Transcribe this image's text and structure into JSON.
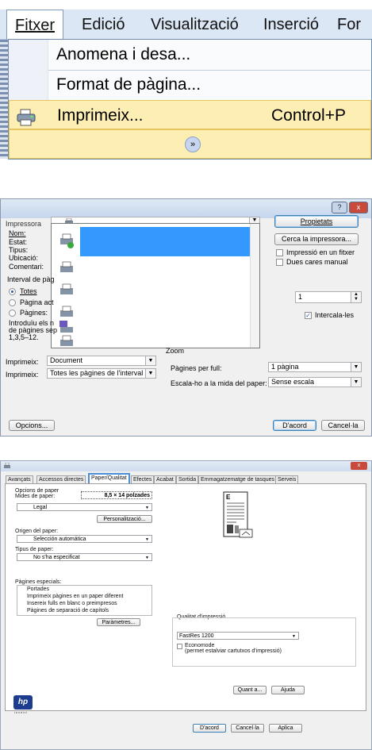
{
  "menu": {
    "items": [
      "Fitxer",
      "Edició",
      "Visualització",
      "Inserció",
      "For"
    ],
    "dropdown": {
      "save_as": "Anomena i desa...",
      "page_setup": "Format de pàgina...",
      "print": "Imprimeix...",
      "print_shortcut": "Control+P"
    }
  },
  "print_dialog": {
    "title_buttons": {
      "help": "?",
      "close": "x"
    },
    "printer_group": "Impressora",
    "name_label": "Nom:",
    "status_label": "Estat:",
    "type_label": "Tipus:",
    "location_label": "Ubicació:",
    "comment_label": "Comentari:",
    "properties_button": "Propietats",
    "find_printer_button": "Cerca la impressora...",
    "print_to_file": "Impressió en un fitxer",
    "manual_duplex": "Dues cares manual",
    "range_group": "Interval de pàg",
    "range_all": "Totes",
    "range_current": "Pàgina act",
    "range_pages": "Pàgines:",
    "range_hint_1": "Introduïu els n",
    "range_hint_2": "de pàgines sep",
    "range_hint_3": "1,3,5–12.",
    "copies_value": "1",
    "collate": "Intercala-les",
    "print_what_label": "Imprimeix:",
    "print_what_value": "Document",
    "print_label": "Imprimeix:",
    "print_value": "Totes les pàgines de l'interval",
    "zoom_group": "Zoom",
    "pages_per_sheet_label": "Pàgines per full:",
    "pages_per_sheet_value": "1 pàgina",
    "scale_label": "Escala-ho a la mida del paper:",
    "scale_value": "Sense escala",
    "options_button": "Opcions...",
    "ok_button": "D'acord",
    "cancel_button": "Cancel·la"
  },
  "properties_dialog": {
    "close": "x",
    "tabs": [
      "Avançats",
      "Accessos directes",
      "Paper/Qualitat",
      "Efectes",
      "Acabat",
      "Sortida",
      "Emmagatzematge de tasques",
      "Serveis"
    ],
    "selected_tab": "Paper/Qualitat",
    "paper_options_label": "Opcions de paper",
    "paper_sizes_label": "Mides de paper:",
    "paper_size_value": "8,5 × 14 polzades",
    "paper_type_value": "Legal",
    "custom_button": "Personalització...",
    "paper_source_label": "Origen del paper:",
    "paper_source_value": "Selección automática",
    "paper_kind_label": "Tipus de paper:",
    "paper_kind_value": "No s'ha especificat",
    "special_pages_label": "Pàgines especials:",
    "special_pages": [
      "Portades",
      "Imprimeix pàgines en un paper diferent",
      "Insereix fulls en blanc o preimpresos",
      "Pàgines de separació de capítols"
    ],
    "parameters_button": "Paràmetres...",
    "quality_label": "Qualitat d'impressió",
    "quality_value": "FastRes 1200",
    "economode_label": "Economode",
    "economode_note": "(permet estalviar cartutxos d'impressió)",
    "about_button": "Quant a...",
    "help_button": "Ajuda",
    "ok_button": "D'acord",
    "cancel_button": "Cancel·la",
    "apply_button": "Aplica",
    "logo_text": "hp",
    "logo_sub": "invent"
  }
}
